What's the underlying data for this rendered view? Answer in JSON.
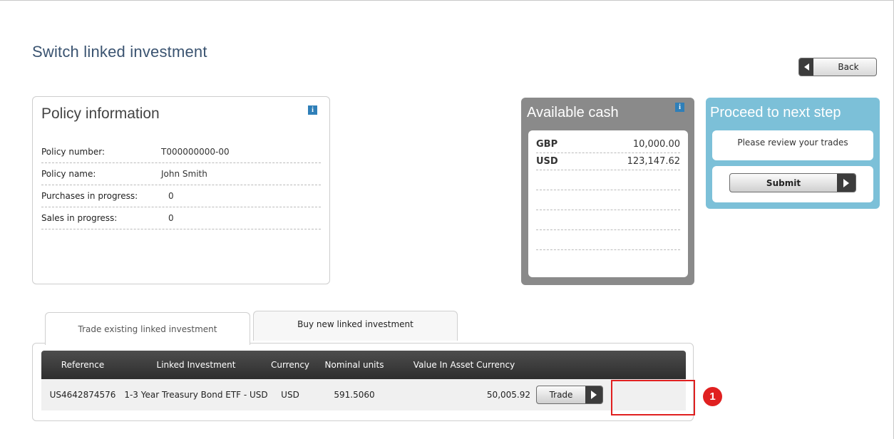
{
  "page": {
    "title": "Switch linked investment",
    "back_label": "Back"
  },
  "policy": {
    "title": "Policy information",
    "info_icon": "i",
    "rows": [
      {
        "label": "Policy number:",
        "value": "T000000000-00"
      },
      {
        "label": "Policy name:",
        "value": "John Smith"
      },
      {
        "label": "Purchases in progress:",
        "value": "0"
      },
      {
        "label": "Sales in progress:",
        "value": "0"
      }
    ]
  },
  "cash": {
    "title": "Available cash",
    "info_icon": "i",
    "rows": [
      {
        "currency": "GBP",
        "amount": "10,000.00"
      },
      {
        "currency": "USD",
        "amount": "123,147.62"
      }
    ]
  },
  "proceed": {
    "title": "Proceed to next step",
    "message": "Please review your trades",
    "submit_label": "Submit"
  },
  "tabs": [
    {
      "label": "Trade existing linked investment",
      "active": true
    },
    {
      "label": "Buy new linked investment",
      "active": false
    }
  ],
  "table": {
    "columns": [
      "Reference",
      "Linked Investment",
      "Currency",
      "Nominal units",
      "Value In Asset Currency"
    ],
    "rows": [
      {
        "reference": "US4642874576",
        "investment": "1-3 Year Treasury Bond ETF - USD",
        "currency": "USD",
        "nominal_units": "591.5060",
        "value": "50,005.92",
        "action_label": "Trade"
      }
    ]
  },
  "annotation": {
    "callout_number": "1",
    "color": "#e02020"
  },
  "colors": {
    "title_blue": "#3a5370",
    "cash_panel": "#8a8a8a",
    "proceed_panel": "#7cc0d8",
    "info_icon": "#2f7fb8",
    "table_header": "#3a3a3a"
  }
}
